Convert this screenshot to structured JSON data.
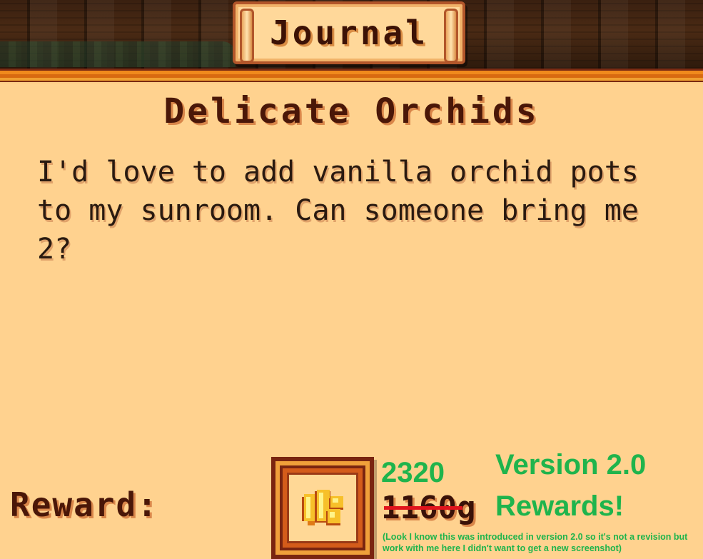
{
  "header": {
    "tab_title": "Journal"
  },
  "quest": {
    "title": "Delicate Orchids",
    "description": "I'd love to add vanilla orchid pots to my sunroom. Can someone bring me 2?"
  },
  "reward": {
    "label": "Reward:",
    "icon": "gold-coins-icon",
    "old_amount": "1160g",
    "new_amount": "2320"
  },
  "annotation": {
    "headline": "Version 2.0 Rewards!",
    "footnote": "(Look I know this was introduced in version 2.0 so it's not a revision but work with me here I didn't want to get a new screenshot)",
    "color": "#1fb44c",
    "strike_color": "#e0141c"
  }
}
